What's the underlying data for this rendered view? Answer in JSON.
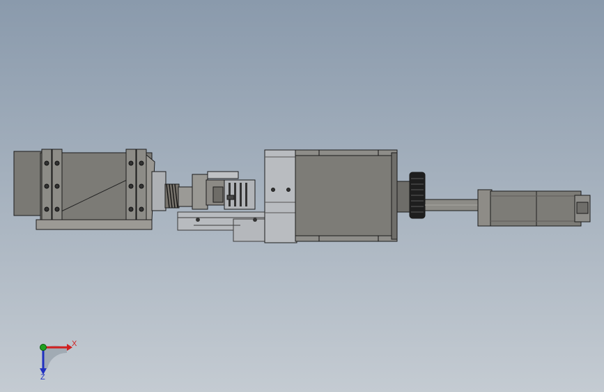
{
  "colors": {
    "background_top": "#8a9aac",
    "background_bottom": "#c4cbd2",
    "metal_dark": "#6f6e6b",
    "metal_mid": "#8f8d88",
    "metal_light": "#b3b6ba",
    "edge": "#1b1b1b",
    "axis_x": "#d02020",
    "axis_y": "#20a020",
    "axis_z": "#2030c0"
  },
  "model": {
    "parts": [
      "gear-motor-housing",
      "mounting-bracket",
      "spring-coupling",
      "flexible-coupling",
      "base-slide",
      "stepper-motor",
      "adjustment-knob",
      "shaft",
      "servo-motor"
    ]
  },
  "triad": {
    "x_label": "X",
    "z_label": "Z"
  }
}
